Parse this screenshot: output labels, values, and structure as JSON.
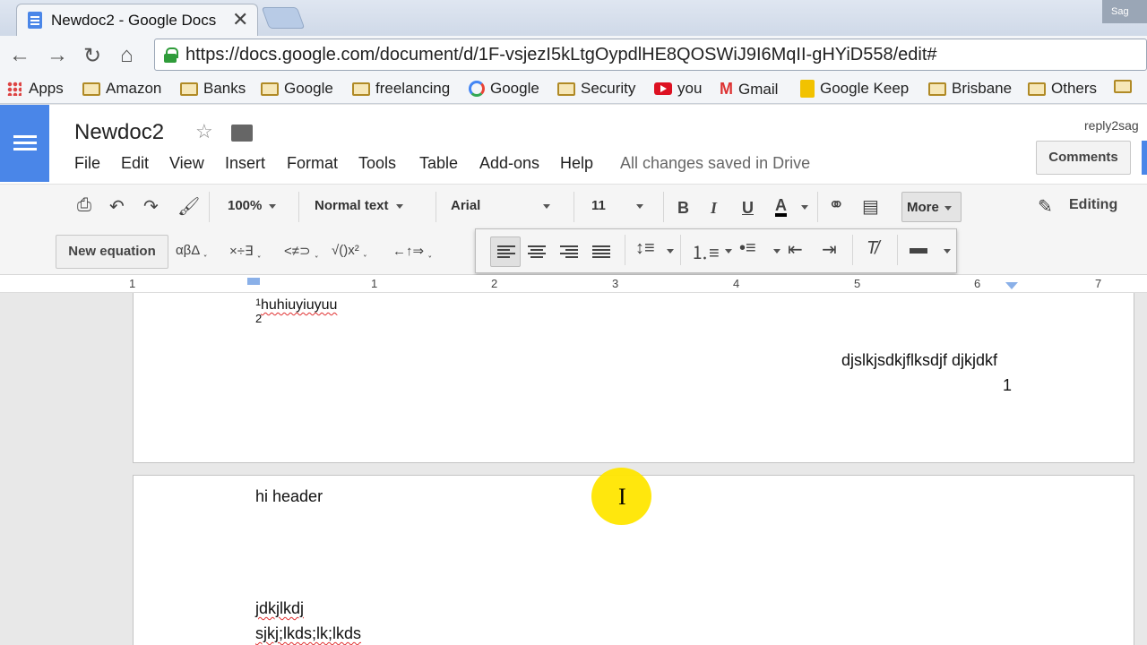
{
  "browser": {
    "tab_title": "Newdoc2 - Google Docs",
    "tab_close": "✕",
    "profile": "Sag",
    "url": "https://docs.google.com/document/d/1F-vsjezI5kLtgOypdlHE8QOSWiJ9I6MqII-gHYiD558/edit#",
    "bookmarks": [
      "Apps",
      "Amazon",
      "Banks",
      "Google",
      "freelancing",
      "Google",
      "Security",
      "you",
      "Gmail",
      "Google Keep",
      "Brisbane",
      "Others"
    ]
  },
  "docs": {
    "title": "Newdoc2",
    "menus": [
      "File",
      "Edit",
      "View",
      "Insert",
      "Format",
      "Tools",
      "Table",
      "Add-ons",
      "Help"
    ],
    "save_status": "All changes saved in Drive",
    "user": "reply2sag",
    "comments_label": "Comments"
  },
  "toolbar": {
    "zoom": "100%",
    "style": "Normal text",
    "font": "Arial",
    "size": "11",
    "bold": "B",
    "italic": "I",
    "underline": "U",
    "text_color": "A",
    "more_label": "More",
    "mode_label": "Editing"
  },
  "equation_bar": {
    "new_equation": "New equation",
    "groups": [
      "αβΔ",
      "×÷∃",
      "<≠⊃",
      "√()x²",
      "←↑⇒"
    ]
  },
  "ruler": {
    "numbers": [
      "1",
      "1",
      "2",
      "3",
      "4",
      "5",
      "6",
      "7"
    ]
  },
  "document": {
    "page1": {
      "footnote_text": "huhiuyiuyuu",
      "sup1": "1",
      "sup2": "2",
      "right_text": "djslkjsdkjflksdjf djkjdkf",
      "page_number": "1"
    },
    "page2": {
      "header": "hi header",
      "line1": "jdkjlkdj",
      "line2": "sjkj;lkds;lk;lkds"
    }
  },
  "colors": {
    "docs_blue": "#4a86e8",
    "highlight_ring": "#ffe600",
    "spellcheck": "#e03030"
  }
}
